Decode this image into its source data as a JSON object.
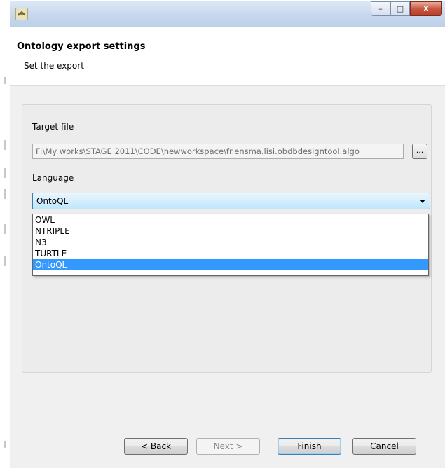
{
  "window": {
    "icon": "eclipse-app-icon",
    "controls": {
      "minimize": "–",
      "maximize": "□",
      "close": "X"
    }
  },
  "header": {
    "title": "Ontology export settings",
    "description": "Set the export"
  },
  "form": {
    "target_file_label": "Target file",
    "target_file_value": "F:\\My works\\STAGE 2011\\CODE\\newworkspace\\fr.ensma.lisi.obdbdesigntool.algo",
    "browse_label": "...",
    "language_label": "Language",
    "language_selected": "OntoQL",
    "language_options": [
      "OWL",
      "NTRIPLE",
      "N3",
      "TURTLE",
      "OntoQL"
    ]
  },
  "buttons": {
    "back": "< Back",
    "next": "Next >",
    "finish": "Finish",
    "cancel": "Cancel"
  },
  "colors": {
    "selection": "#3399ff",
    "close_button": "#c6523b"
  }
}
